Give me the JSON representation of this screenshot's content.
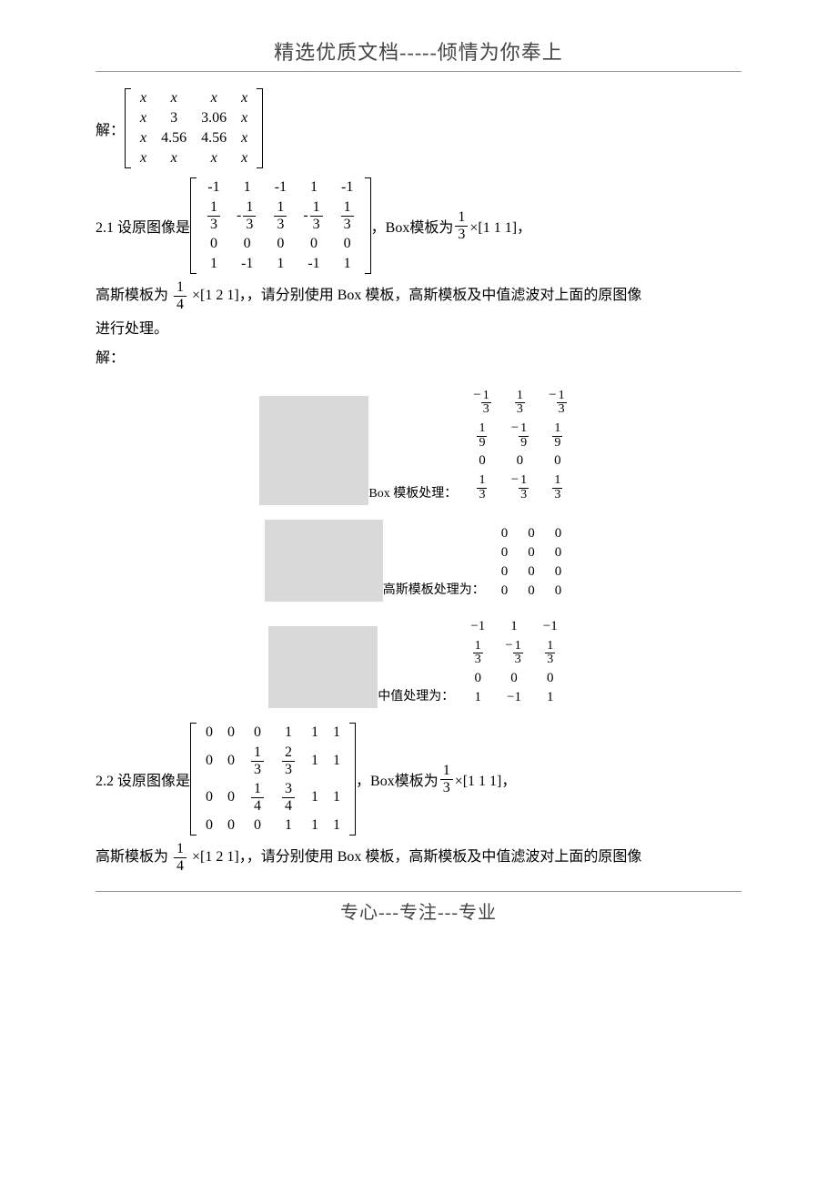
{
  "header": "精选优质文档-----倾情为你奉上",
  "footer": "专心---专注---专业",
  "solve_label": "解：",
  "matrix1": {
    "rows": [
      [
        "x",
        "x",
        "x",
        "x"
      ],
      [
        "x",
        "3",
        "3.06",
        "x"
      ],
      [
        "x",
        "4.56",
        "4.56",
        "x"
      ],
      [
        "x",
        "x",
        "x",
        "x"
      ]
    ]
  },
  "p21_prefix": "2.1 设原图像是",
  "matrix2_rows": [
    [
      "-1",
      "1",
      "-1",
      "1",
      "-1"
    ],
    [
      "1/3",
      "-1/3",
      "1/3",
      "-1/3",
      "1/3"
    ],
    [
      "0",
      "0",
      "0",
      "0",
      "0"
    ],
    [
      "1",
      "-1",
      "1",
      "-1",
      "1"
    ]
  ],
  "box_text_a": "，Box模板为",
  "box_frac": {
    "n": "1",
    "d": "3"
  },
  "box_vec": "×[1  1  1]，",
  "gauss_text_a": "高斯模板为",
  "gauss_frac": {
    "n": "1",
    "d": "4"
  },
  "gauss_row": "×[1  2  1]，，请分别使用 Box 模板，高斯模板及中值滤波对上面的原图像",
  "line_process": "进行处理。",
  "solve2": "解：",
  "box_result_label": "Box 模板处理：",
  "box_result": [
    [
      "-1/3",
      "1/3",
      "-1/3"
    ],
    [
      "1/9",
      "-1/9",
      "1/9"
    ],
    [
      "0",
      "0",
      "0"
    ],
    [
      "1/3",
      "-1/3",
      "1/3"
    ]
  ],
  "gauss_result_label": "高斯模板处理为：",
  "gauss_result": [
    [
      "0",
      "0",
      "0"
    ],
    [
      "0",
      "0",
      "0"
    ],
    [
      "0",
      "0",
      "0"
    ],
    [
      "0",
      "0",
      "0"
    ]
  ],
  "median_result_label": "中值处理为：",
  "median_result": [
    [
      "-1",
      "1",
      "-1"
    ],
    [
      "1/3",
      "-1/3",
      "1/3"
    ],
    [
      "0",
      "0",
      "0"
    ],
    [
      "1",
      "-1",
      "1"
    ]
  ],
  "p22_prefix": "2.2 设原图像是",
  "matrix3_rows": [
    [
      "0",
      "0",
      "0",
      "1",
      "1",
      "1"
    ],
    [
      "0",
      "0",
      "1/3",
      "2/3",
      "1",
      "1"
    ],
    [
      "0",
      "0",
      "1/4",
      "3/4",
      "1",
      "1"
    ],
    [
      "0",
      "0",
      "0",
      "1",
      "1",
      "1"
    ]
  ],
  "chart_data": {
    "type": "table",
    "title": "Image filtering problem data",
    "matrices": {
      "solution_matrix": [
        [
          "x",
          "x",
          "x",
          "x"
        ],
        [
          "x",
          "3",
          "3.06",
          "x"
        ],
        [
          "x",
          "4.56",
          "4.56",
          "x"
        ],
        [
          "x",
          "x",
          "x",
          "x"
        ]
      ],
      "source_image_2_1": [
        [
          -1,
          1,
          -1,
          1,
          -1
        ],
        [
          "1/3",
          "-1/3",
          "1/3",
          "-1/3",
          "1/3"
        ],
        [
          0,
          0,
          0,
          0,
          0
        ],
        [
          1,
          -1,
          1,
          -1,
          1
        ]
      ],
      "box_template": {
        "factor": "1/3",
        "kernel": [
          1,
          1,
          1
        ]
      },
      "gauss_template": {
        "factor": "1/4",
        "kernel": [
          1,
          2,
          1
        ]
      },
      "box_result": [
        [
          "-1/3",
          "1/3",
          "-1/3"
        ],
        [
          "1/9",
          "-1/9",
          "1/9"
        ],
        [
          0,
          0,
          0
        ],
        [
          "1/3",
          "-1/3",
          "1/3"
        ]
      ],
      "gauss_result": [
        [
          0,
          0,
          0
        ],
        [
          0,
          0,
          0
        ],
        [
          0,
          0,
          0
        ],
        [
          0,
          0,
          0
        ]
      ],
      "median_result": [
        [
          -1,
          1,
          -1
        ],
        [
          "1/3",
          "-1/3",
          "1/3"
        ],
        [
          0,
          0,
          0
        ],
        [
          1,
          -1,
          1
        ]
      ],
      "source_image_2_2": [
        [
          0,
          0,
          0,
          1,
          1,
          1
        ],
        [
          0,
          0,
          "1/3",
          "2/3",
          1,
          1
        ],
        [
          0,
          0,
          "1/4",
          "3/4",
          1,
          1
        ],
        [
          0,
          0,
          0,
          1,
          1,
          1
        ]
      ]
    }
  }
}
